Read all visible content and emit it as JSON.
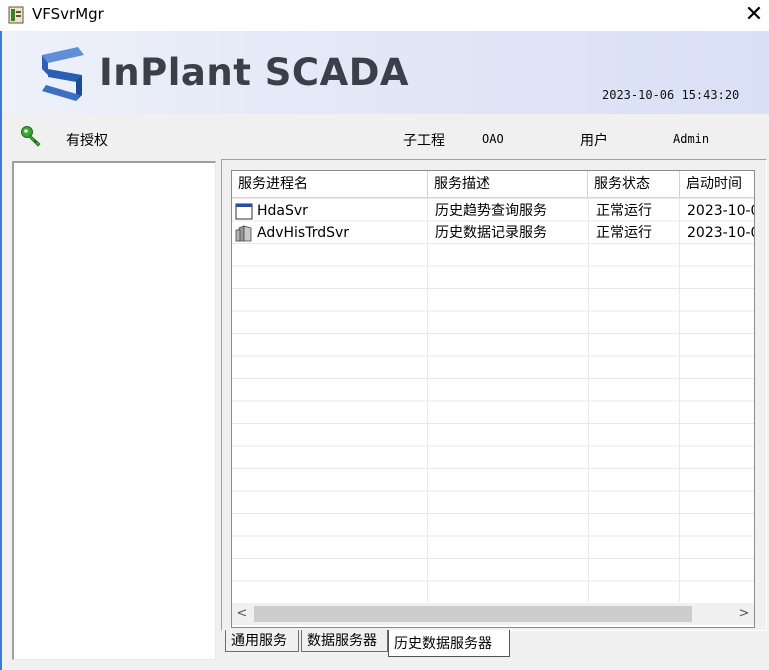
{
  "window": {
    "title": "VFSvrMgr",
    "close_glyph": "✕"
  },
  "banner": {
    "logo_text": "InPlant SCADA",
    "datetime": "2023-10-06 15:43:20"
  },
  "info": {
    "license_status": "有授权",
    "project_label": "子工程",
    "project_value": "OAO",
    "user_label": "用户",
    "user_value": "Admin"
  },
  "table": {
    "columns": [
      "服务进程名",
      "服务描述",
      "服务状态",
      "启动时间"
    ],
    "rows": [
      {
        "name": "HdaSvr",
        "description": "历史趋势查询服务",
        "status": "正常运行",
        "start_time": "2023-10-0",
        "icon": "window-icon"
      },
      {
        "name": "AdvHisTrdSvr",
        "description": "历史数据记录服务",
        "status": "正常运行",
        "start_time": "2023-10-0",
        "icon": "server-icon"
      }
    ]
  },
  "scrollbar": {
    "left_arrow": "<",
    "right_arrow": ">"
  },
  "tabs": [
    {
      "label": "通用服务",
      "active": false
    },
    {
      "label": "数据服务器",
      "active": false
    },
    {
      "label": "历史数据服务器",
      "active": true
    }
  ],
  "colors": {
    "logo_blue": "#2b5fb3",
    "logo_text": "#3a3f4a",
    "key_green": "#3aa832",
    "window_accent": "#3a7bd5"
  }
}
